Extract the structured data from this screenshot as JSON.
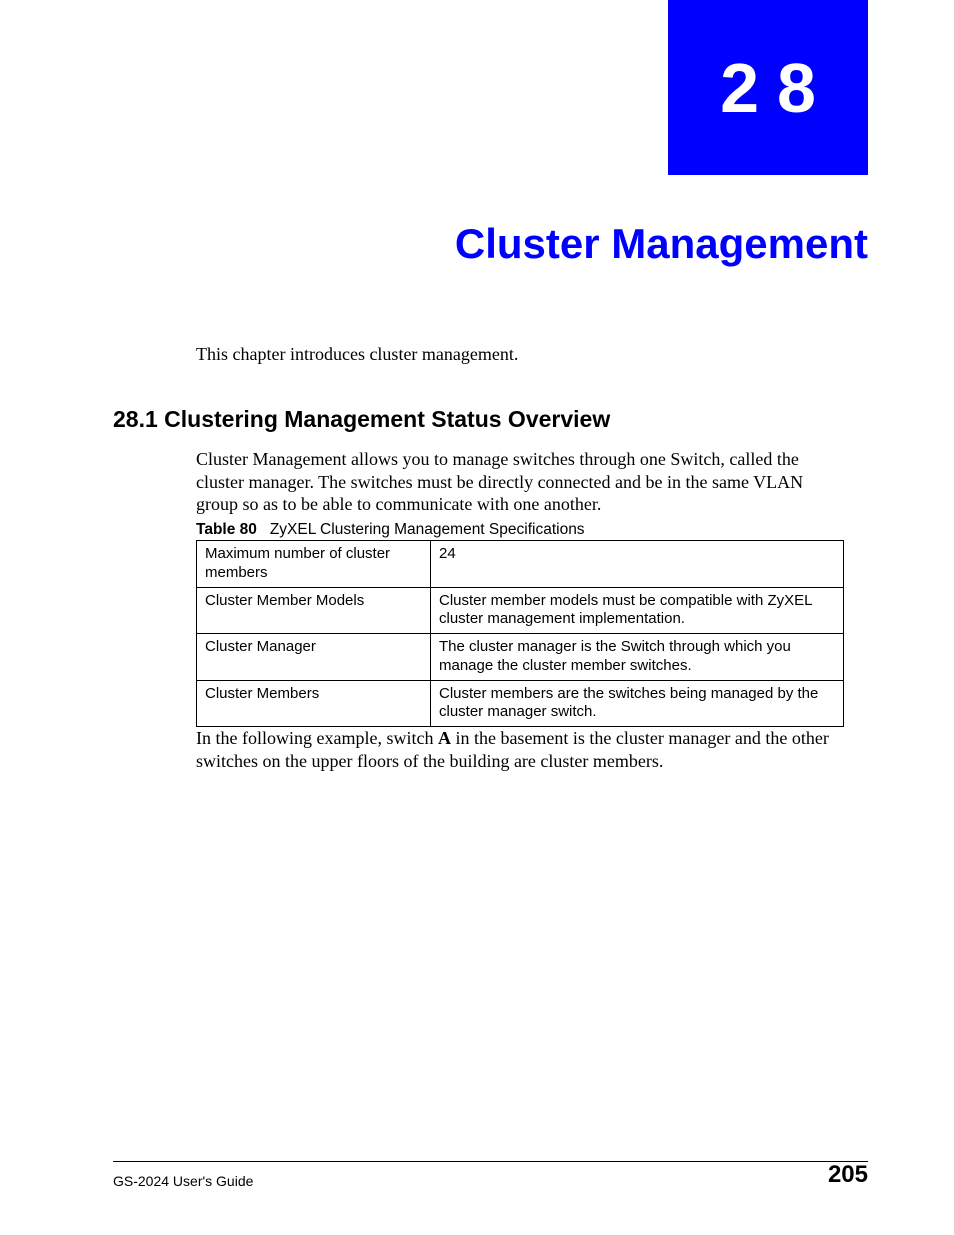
{
  "chapter": {
    "number": "28",
    "title": "Cluster Management"
  },
  "intro": "This chapter introduces cluster management.",
  "section": {
    "heading": "28.1  Clustering Management Status Overview",
    "body": "Cluster Management allows you to manage switches through one Switch, called the cluster manager. The switches must be directly connected and be in the same VLAN group so as to be able to communicate with one another."
  },
  "table": {
    "caption_label": "Table 80",
    "caption_text": "ZyXEL Clustering Management Specifications",
    "rows": [
      {
        "k": "Maximum number of cluster members",
        "v": "24"
      },
      {
        "k": "Cluster Member Models",
        "v": "Cluster member models must be compatible with ZyXEL cluster management implementation."
      },
      {
        "k": "Cluster Manager",
        "v": "The cluster manager is the Switch through which you manage the cluster member switches."
      },
      {
        "k": "Cluster Members",
        "v": "Cluster members are the switches being managed by the cluster manager switch."
      }
    ]
  },
  "after_table": {
    "pre": "In the following example, switch ",
    "bold": "A",
    "post": " in the basement is the cluster manager and the other switches on the upper floors of the building are cluster members."
  },
  "footer": {
    "guide": "GS-2024 User's Guide",
    "page": "205"
  }
}
